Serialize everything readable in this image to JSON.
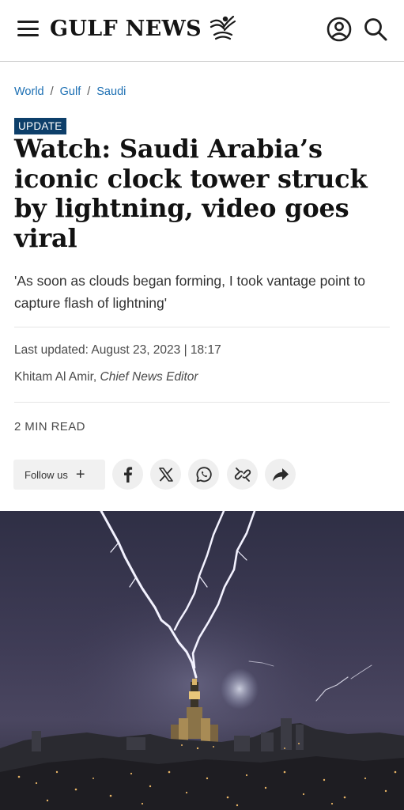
{
  "header": {
    "logo_text": "GULF NEWS",
    "icons": {
      "menu": "hamburger-menu-icon",
      "logo": "falcon-logo-icon",
      "account": "user-account-icon",
      "search": "search-icon"
    }
  },
  "breadcrumb": [
    {
      "label": "World"
    },
    {
      "label": "Gulf"
    },
    {
      "label": "Saudi"
    }
  ],
  "breadcrumb_separator": "/",
  "article": {
    "badge": "UPDATE",
    "headline": "Watch: Saudi Arabia’s iconic clock tower struck by lightning, video goes viral",
    "summary": "'As soon as clouds began forming, I took vantage point to capture flash of lightning'",
    "last_updated": "Last updated: August 23, 2023 | 18:17",
    "author_name": "Khitam Al Amir,",
    "author_title": "Chief News Editor",
    "read_time": "2 MIN READ"
  },
  "social": {
    "follow_label": "Follow us",
    "follow_plus": "+",
    "share_icons": [
      "facebook-icon",
      "x-twitter-icon",
      "whatsapp-icon",
      "copy-link-icon",
      "share-arrow-icon"
    ]
  },
  "colors": {
    "accent_link": "#1c6fb3",
    "badge_bg": "#0d3f6a",
    "hero_sky": "#3d3a52"
  }
}
